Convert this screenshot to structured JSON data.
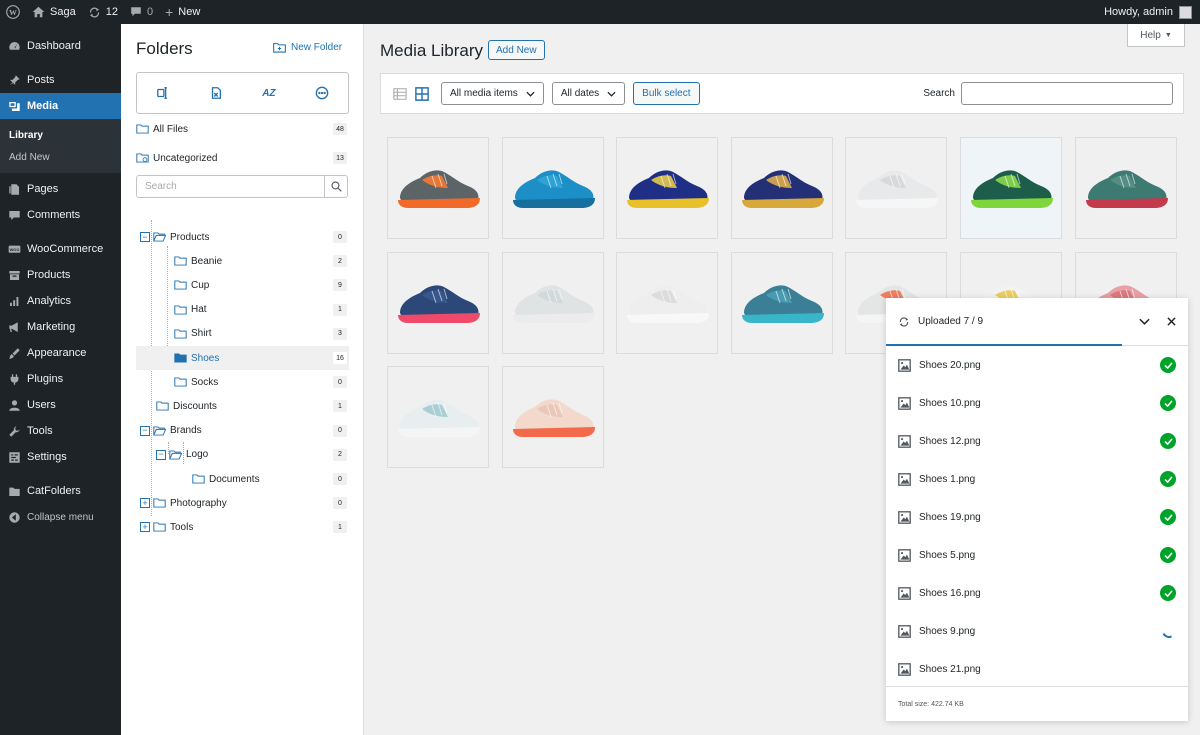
{
  "adminbar": {
    "site_name": "Saga",
    "updates_count": "12",
    "comments_count": "0",
    "new_label": "New",
    "howdy": "Howdy, admin"
  },
  "menu": {
    "items": [
      {
        "label": "Dashboard",
        "icon": "dashboard-icon"
      },
      {
        "label": "Posts",
        "icon": "pin-icon"
      },
      {
        "label": "Media",
        "icon": "media-icon",
        "active": true
      },
      {
        "label": "Pages",
        "icon": "page-icon"
      },
      {
        "label": "Comments",
        "icon": "comment-icon"
      },
      {
        "label": "WooCommerce",
        "icon": "woo-icon"
      },
      {
        "label": "Products",
        "icon": "archive-icon"
      },
      {
        "label": "Analytics",
        "icon": "bar-chart-icon"
      },
      {
        "label": "Marketing",
        "icon": "megaphone-icon"
      },
      {
        "label": "Appearance",
        "icon": "brush-icon"
      },
      {
        "label": "Plugins",
        "icon": "plug-icon"
      },
      {
        "label": "Users",
        "icon": "user-icon"
      },
      {
        "label": "Tools",
        "icon": "wrench-icon"
      },
      {
        "label": "Settings",
        "icon": "settings-icon"
      },
      {
        "label": "CatFolders",
        "icon": "folder-icon"
      },
      {
        "label": "Collapse menu",
        "icon": "collapse-icon"
      }
    ],
    "submenu": [
      "Library",
      "Add New"
    ]
  },
  "folders": {
    "title": "Folders",
    "new_folder": "New Folder",
    "toolbar_sort": "AZ",
    "search_placeholder": "Search",
    "all_files": {
      "label": "All Files",
      "count": "48"
    },
    "uncategorized": {
      "label": "Uncategorized",
      "count": "13"
    },
    "tree": [
      {
        "label": "Products",
        "count": "0",
        "level": 0,
        "toggle": "−"
      },
      {
        "label": "Beanie",
        "count": "2",
        "level": 1
      },
      {
        "label": "Cup",
        "count": "9",
        "level": 1
      },
      {
        "label": "Hat",
        "count": "1",
        "level": 1
      },
      {
        "label": "Shirt",
        "count": "3",
        "level": 1
      },
      {
        "label": "Shoes",
        "count": "16",
        "level": 1,
        "selected": true
      },
      {
        "label": "Socks",
        "count": "0",
        "level": 1
      },
      {
        "label": "Discounts",
        "count": "1",
        "level": 0.5
      },
      {
        "label": "Brands",
        "count": "0",
        "level": 0,
        "toggle": "−"
      },
      {
        "label": "Logo",
        "count": "2",
        "level": 1,
        "toggle": "−"
      },
      {
        "label": "Documents",
        "count": "0",
        "level": 2
      },
      {
        "label": "Photography",
        "count": "0",
        "level": 0,
        "toggle": "+"
      },
      {
        "label": "Tools",
        "count": "1",
        "level": 0,
        "toggle": "+"
      }
    ]
  },
  "main": {
    "help_label": "Help",
    "title": "Media Library",
    "add_new": "Add New",
    "filter_type": "All media items",
    "filter_date": "All dates",
    "bulk_select": "Bulk select",
    "search_label": "Search",
    "thumbnails": [
      {
        "upper": "#5d6468",
        "sole": "#f26a2a",
        "accent": "#ff7a30",
        "bg": "#f0f0f1"
      },
      {
        "upper": "#1c8fc6",
        "sole": "#1570a0",
        "accent": "#33a6d8",
        "bg": "#f0f0f1"
      },
      {
        "upper": "#1f2f85",
        "sole": "#e8c02a",
        "accent": "#f2d24a",
        "bg": "#f0f0f1"
      },
      {
        "upper": "#233075",
        "sole": "#d8a83a",
        "accent": "#e8b44a",
        "bg": "#f0f0f1"
      },
      {
        "upper": "#e8e9ea",
        "sole": "#f6f6f6",
        "accent": "#d6d6d6",
        "bg": "#f0f0f1"
      },
      {
        "upper": "#1e5d4a",
        "sole": "#7fd63a",
        "accent": "#8fe04a",
        "bg": "#eef4f7"
      },
      {
        "upper": "#3c7a72",
        "sole": "#c43a4a",
        "accent": "#5a9088",
        "bg": "#f0f0f1"
      },
      {
        "upper": "#2c4878",
        "sole": "#f04a6a",
        "accent": "#3a5a90",
        "bg": "#f0f0f1"
      },
      {
        "upper": "#dfe3e3",
        "sole": "#ececec",
        "accent": "#cfd8d8",
        "bg": "#f0f0f1"
      },
      {
        "upper": "#eeeeee",
        "sole": "#f8f8f8",
        "accent": "#d8d8d8",
        "bg": "#f0f0f1"
      },
      {
        "upper": "#3a7f96",
        "sole": "#38b5c8",
        "accent": "#4ba0b5",
        "bg": "#f0f0f1"
      },
      {
        "upper": "#e4e6e6",
        "sole": "#f5f5f5",
        "accent": "#f26a4a",
        "bg": "#f0f0f1"
      },
      {
        "upper": "#f2f2f2",
        "sole": "#f8f8f8",
        "accent": "#e8c84a",
        "bg": "#f0f0f1"
      },
      {
        "upper": "#e8a0a4",
        "sole": "#f1c0c3",
        "accent": "#d87078",
        "bg": "#f0f0f1"
      },
      {
        "upper": "#e8eef0",
        "sole": "#f4f6f6",
        "accent": "#9fc8cf",
        "bg": "#f0f0f1"
      },
      {
        "upper": "#f3d8cc",
        "sole": "#f26a4a",
        "accent": "#e8c4b4",
        "bg": "#f0f0f1"
      }
    ]
  },
  "uploader": {
    "title": "Uploaded 7 / 9",
    "progress": 0.78,
    "files": [
      {
        "name": "Shoes 20.png",
        "status": "done"
      },
      {
        "name": "Shoes 10.png",
        "status": "done"
      },
      {
        "name": "Shoes 12.png",
        "status": "done"
      },
      {
        "name": "Shoes 1.png",
        "status": "done"
      },
      {
        "name": "Shoes 19.png",
        "status": "done"
      },
      {
        "name": "Shoes 5.png",
        "status": "done"
      },
      {
        "name": "Shoes 16.png",
        "status": "done"
      },
      {
        "name": "Shoes 9.png",
        "status": "uploading"
      },
      {
        "name": "Shoes 21.png",
        "status": "pending"
      }
    ],
    "total": "Total size: 422.74 KB"
  }
}
